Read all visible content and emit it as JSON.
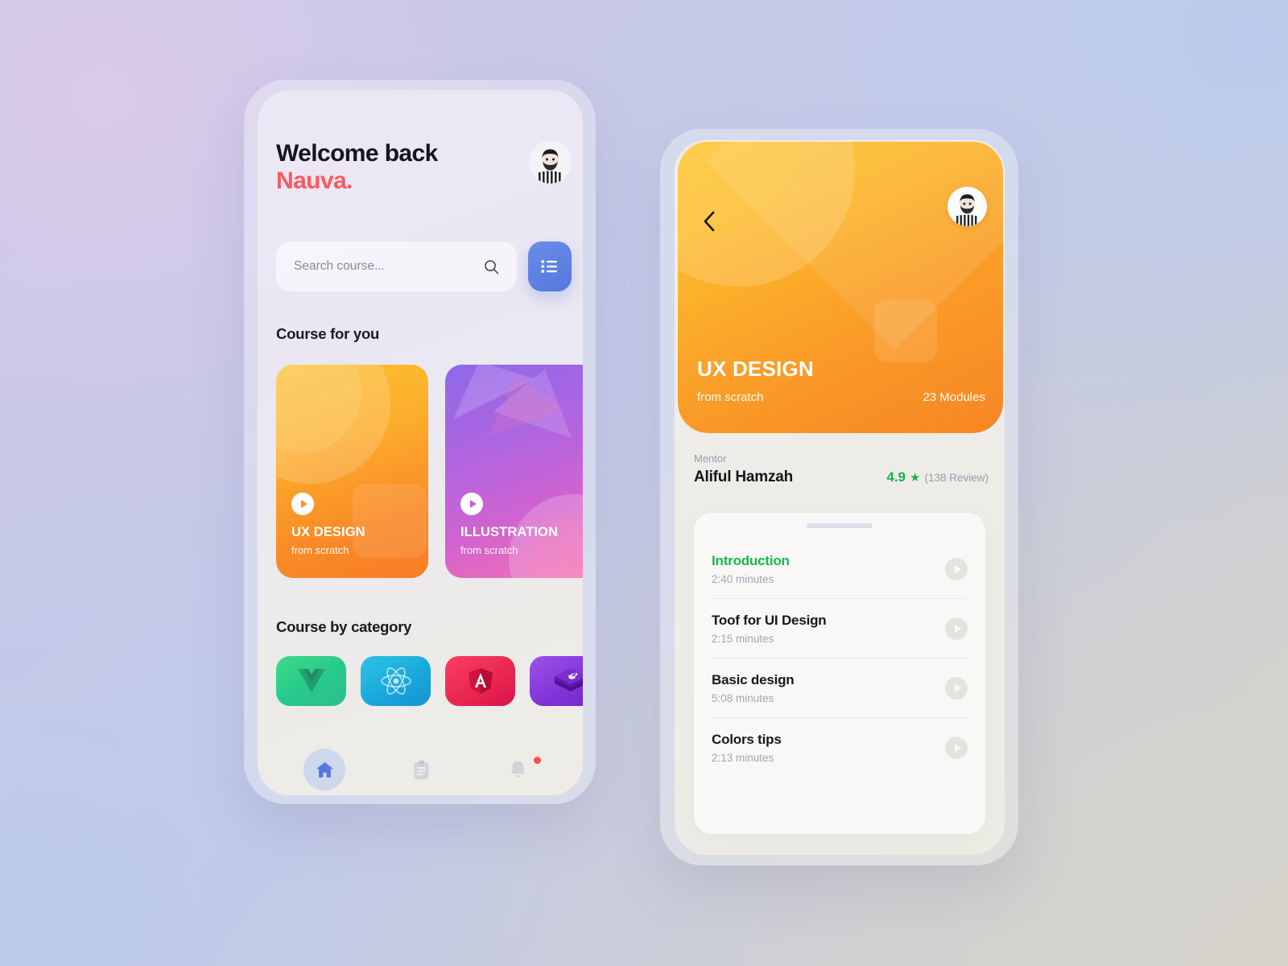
{
  "home": {
    "greeting_line1": "Welcome back",
    "greeting_line2": "Nauva.",
    "avatar_alt": "user-avatar",
    "search": {
      "placeholder": "Search course...",
      "value": "",
      "search_icon": "search-icon",
      "filter_icon": "list-filter-icon"
    },
    "sections": {
      "for_you_title": "Course for you",
      "category_title": "Course by category"
    },
    "courses": [
      {
        "title": "UX DESIGN",
        "subtitle": "from scratch",
        "theme": "orange",
        "play_icon": "play-icon"
      },
      {
        "title": "ILLUSTRATION",
        "subtitle": "from scratch",
        "theme": "purple",
        "play_icon": "play-icon"
      }
    ],
    "categories": [
      {
        "name": "Vue",
        "icon": "vue-logo-icon",
        "color": "#2ec98a"
      },
      {
        "name": "React",
        "icon": "react-logo-icon",
        "color": "#1fa9dc"
      },
      {
        "name": "Angular",
        "icon": "angular-logo-icon",
        "color": "#e8264f"
      },
      {
        "name": "Bootstrap",
        "icon": "bootstrap-logo-icon",
        "color": "#8133d8"
      }
    ],
    "nav": [
      {
        "name": "home",
        "icon": "home-icon",
        "active": true,
        "badge": false
      },
      {
        "name": "tasks",
        "icon": "clipboard-icon",
        "active": false,
        "badge": false
      },
      {
        "name": "notifications",
        "icon": "bell-icon",
        "active": false,
        "badge": true
      }
    ]
  },
  "detail": {
    "back_icon": "chevron-left-icon",
    "avatar_alt": "user-avatar",
    "hero": {
      "title": "UX DESIGN",
      "subtitle": "from scratch",
      "modules": "23 Modules"
    },
    "mentor": {
      "label": "Mentor",
      "name": "Aliful Hamzah",
      "rating": "4.9",
      "star_icon": "★",
      "reviews": "(138 Review)"
    },
    "lessons": [
      {
        "name": "Introduction",
        "time": "2:40 minutes",
        "active": true,
        "play_icon": "play-icon"
      },
      {
        "name": "Toof for UI Design",
        "time": "2:15 minutes",
        "active": false,
        "play_icon": "play-icon"
      },
      {
        "name": "Basic design",
        "time": "5:08 minutes",
        "active": false,
        "play_icon": "play-icon"
      },
      {
        "name": "Colors tips",
        "time": "2:13 minutes",
        "active": false,
        "play_icon": "play-icon"
      }
    ]
  },
  "colors": {
    "accent_red": "#f9595f",
    "accent_blue": "#5578dd",
    "accent_green": "#16b84b",
    "orange_start": "#fdc52f",
    "orange_end": "#f78524",
    "purple_start": "#8e68e8",
    "pink_end": "#f472b0"
  }
}
